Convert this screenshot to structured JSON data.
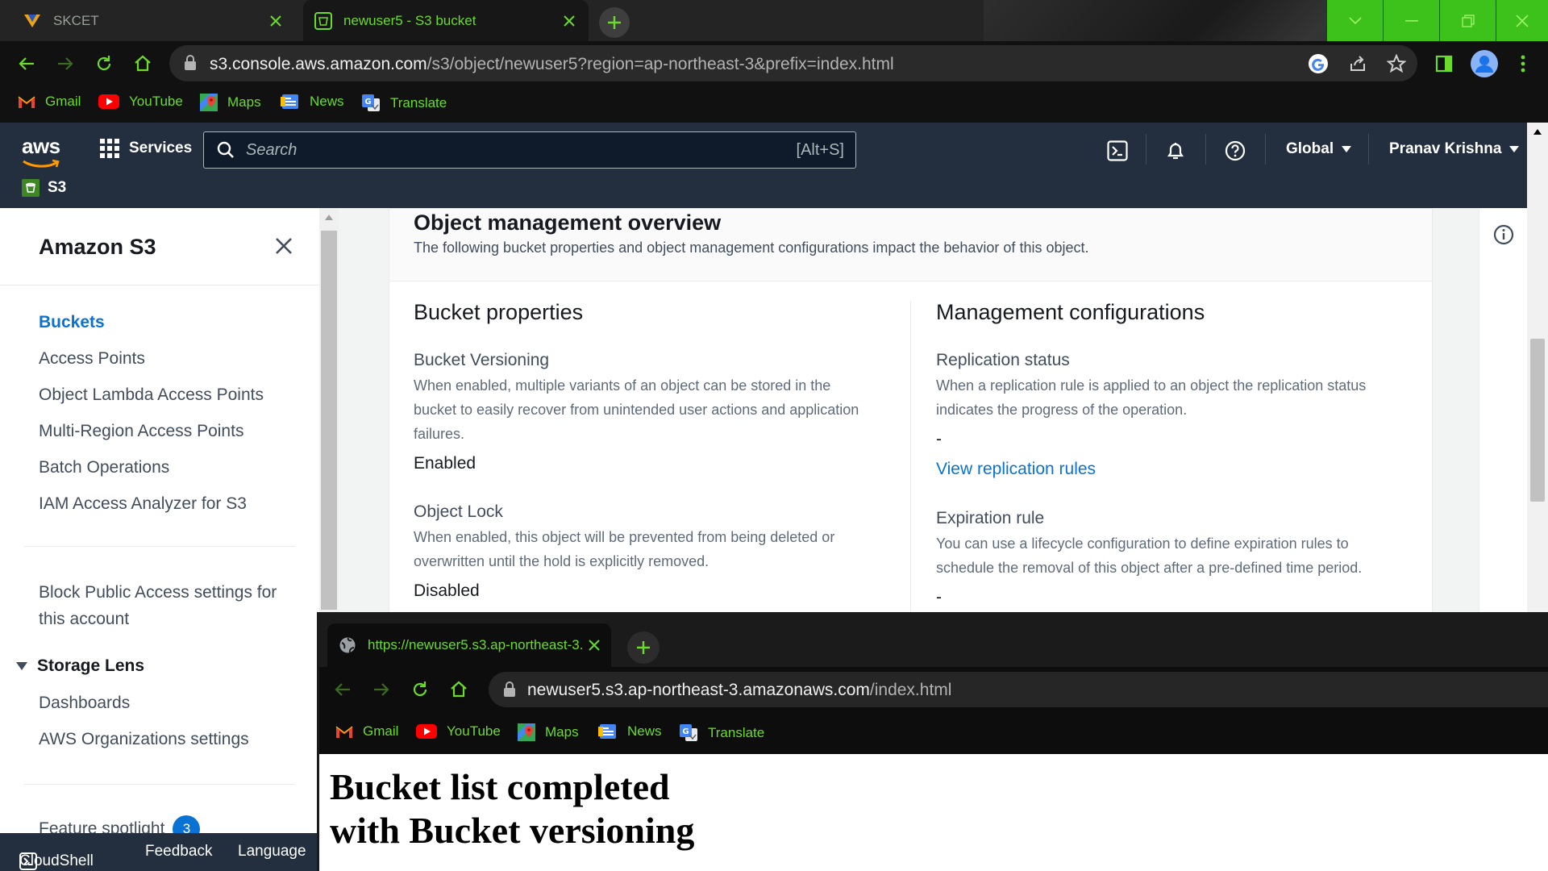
{
  "browser": {
    "tabs": [
      {
        "title": "SKCET",
        "active": false
      },
      {
        "title": "newuser5 - S3 bucket",
        "active": true
      }
    ],
    "address": {
      "host": "s3.console.aws.amazon.com",
      "path": "/s3/object/newuser5?region=ap-northeast-3&prefix=index.html"
    },
    "bookmarks": [
      "Gmail",
      "YouTube",
      "Maps",
      "News",
      "Translate"
    ],
    "accent_color": "#6bdb2a",
    "window_controls_color": "#3dc21b"
  },
  "aws_header": {
    "logo": "aws",
    "services_label": "Services",
    "search_placeholder": "Search",
    "search_shortcut": "[Alt+S]",
    "region": "Global",
    "user": "Pranav Krishna",
    "service_crumb": "S3"
  },
  "sidebar": {
    "title": "Amazon S3",
    "items": [
      {
        "label": "Buckets",
        "active": true
      },
      {
        "label": "Access Points"
      },
      {
        "label": "Object Lambda Access Points"
      },
      {
        "label": "Multi-Region Access Points"
      },
      {
        "label": "Batch Operations"
      },
      {
        "label": "IAM Access Analyzer for S3"
      }
    ],
    "block_public_line1": "Block Public Access settings for",
    "block_public_line2": "this account",
    "storage_lens": {
      "label": "Storage Lens",
      "items": [
        "Dashboards",
        "AWS Organizations settings"
      ]
    },
    "feature_spotlight": {
      "label": "Feature spotlight",
      "badge": "3"
    }
  },
  "bottom_bar": {
    "cloudshell": "CloudShell",
    "feedback": "Feedback",
    "language": "Language"
  },
  "overview": {
    "title": "Object management overview",
    "description": "The following bucket properties and object management configurations impact the behavior of this object.",
    "bucket_properties": {
      "heading": "Bucket properties",
      "versioning": {
        "label": "Bucket Versioning",
        "desc_line1": "When enabled, multiple variants of an object can be stored in the",
        "desc_line2": "bucket to easily recover from unintended user actions and application",
        "desc_line3": "failures.",
        "value": "Enabled"
      },
      "object_lock": {
        "label": "Object Lock",
        "desc_line1": "When enabled, this object will be prevented from being deleted or",
        "desc_line2": "overwritten until the hold is explicitly removed.",
        "value": "Disabled"
      }
    },
    "management": {
      "heading": "Management configurations",
      "replication": {
        "label": "Replication status",
        "desc_line1": "When a replication rule is applied to an object the replication status",
        "desc_line2": "indicates the progress of the operation.",
        "value": "-",
        "link": "View replication rules"
      },
      "expiration": {
        "label": "Expiration rule",
        "desc_line1": "You can use a lifecycle configuration to define expiration rules to",
        "desc_line2": "schedule the removal of this object after a pre-defined time period.",
        "value": "-"
      }
    }
  },
  "overlay_browser": {
    "tab_title": "https://newuser5.s3.ap-northeast-3.",
    "address": {
      "host": "newuser5.s3.ap-northeast-3.amazonaws.com",
      "path": "/index.html"
    },
    "bookmarks": [
      "Gmail",
      "YouTube",
      "Maps",
      "News",
      "Translate"
    ],
    "page_heading_line1": "Bucket list completed",
    "page_heading_line2": "with Bucket versioning"
  }
}
